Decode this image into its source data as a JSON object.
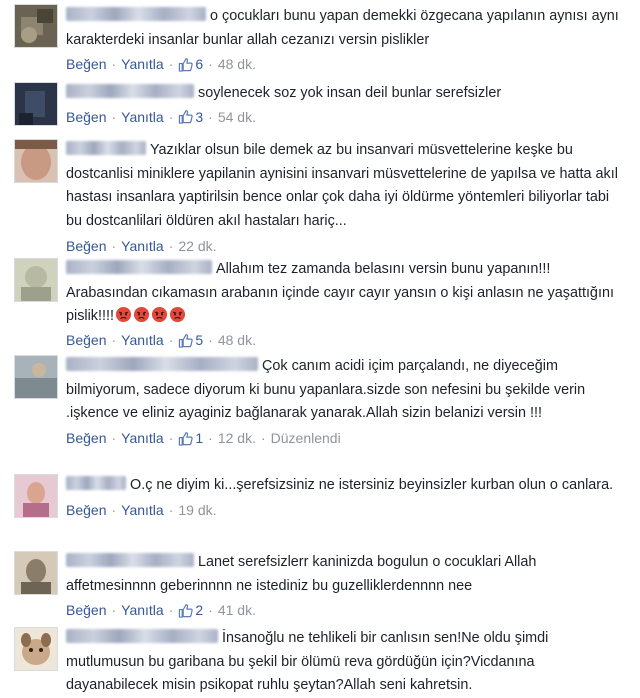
{
  "labels": {
    "like": "Beğen",
    "reply": "Yanıtla",
    "separator": "·"
  },
  "comments": [
    {
      "text": "o çocukları bunu yapan demekki özgecana yapılanın aynısı aynı karakterdeki insanlar bunlar allah cezanızı versin pislikler",
      "likes": "6",
      "time": "48 dk.",
      "edited": "",
      "avatar_color": "#6b6352"
    },
    {
      "text": "soylenecek soz yok insan deil bunlar serefsizler",
      "likes": "3",
      "time": "54 dk.",
      "edited": "",
      "avatar_color": "#2c3547"
    },
    {
      "text": "Yazıklar olsun bile demek az bu insanvari müsvettelerine keşke bu dostcanlisi miniklere yapilanin aynisini insanvari müsvettelerine de yapılsa ve hatta akıl hastası insanlara yaptirilsin bence onlar çok daha iyi öldürme yöntemleri biliyorlar tabi bu dostcanlilari öldüren akıl hastaları hariç...",
      "likes": "",
      "time": "22 dk.",
      "edited": "",
      "avatar_color": "#c99a83"
    },
    {
      "text": "Allahım tez zamanda belasını versin bunu yapanın!!! Arabasından cıkamasın arabanın içinde cayır cayır yansın o kişi anlasın ne yaşattığını pislik!!!!",
      "likes": "5",
      "time": "48 dk.",
      "edited": "",
      "avatar_color": "#b7b9a2",
      "emoji_count": "4"
    },
    {
      "text": "Çok canım acidi içim parçalandı, ne diyeceğim bilmiyorum, sadece diyorum ki bunu yapanlara.sizde son nefesini bu şekilde verin .işkence ve eliniz ayaginiz bağlanarak yanarak.Allah sizin belanizi versin !!!",
      "likes": "1",
      "time": "12 dk.",
      "edited": "Düzenlendi",
      "avatar_color": "#7d8a8f"
    },
    {
      "text": "O.ç ne diyim ki...şerefsizsiniz ne istersiniz beyinsizler kurban olun o canlara.",
      "likes": "",
      "time": "19 dk.",
      "edited": "",
      "avatar_color": "#b46d8a"
    },
    {
      "text": "Lanet serefsizlerr kaninizda bogulun o cocuklari Allah affetmesinnnn geberinnnn ne istediniz bu guzelliklerdennnn nee",
      "likes": "2",
      "time": "41 dk.",
      "edited": "",
      "avatar_color": "#8a7e6b"
    },
    {
      "text": "İnsanoğlu ne tehlikeli bir canlısın sen!Ne oldu şimdi mutlumusun bu garibana bu şekil bir ölümü reva gördüğün için?Vicdanına dayanabilecek misin psikopat ruhlu şeytan?Allah seni kahretsin.",
      "likes": "",
      "time": "",
      "edited": "",
      "avatar_color": "#c9a98a"
    }
  ]
}
